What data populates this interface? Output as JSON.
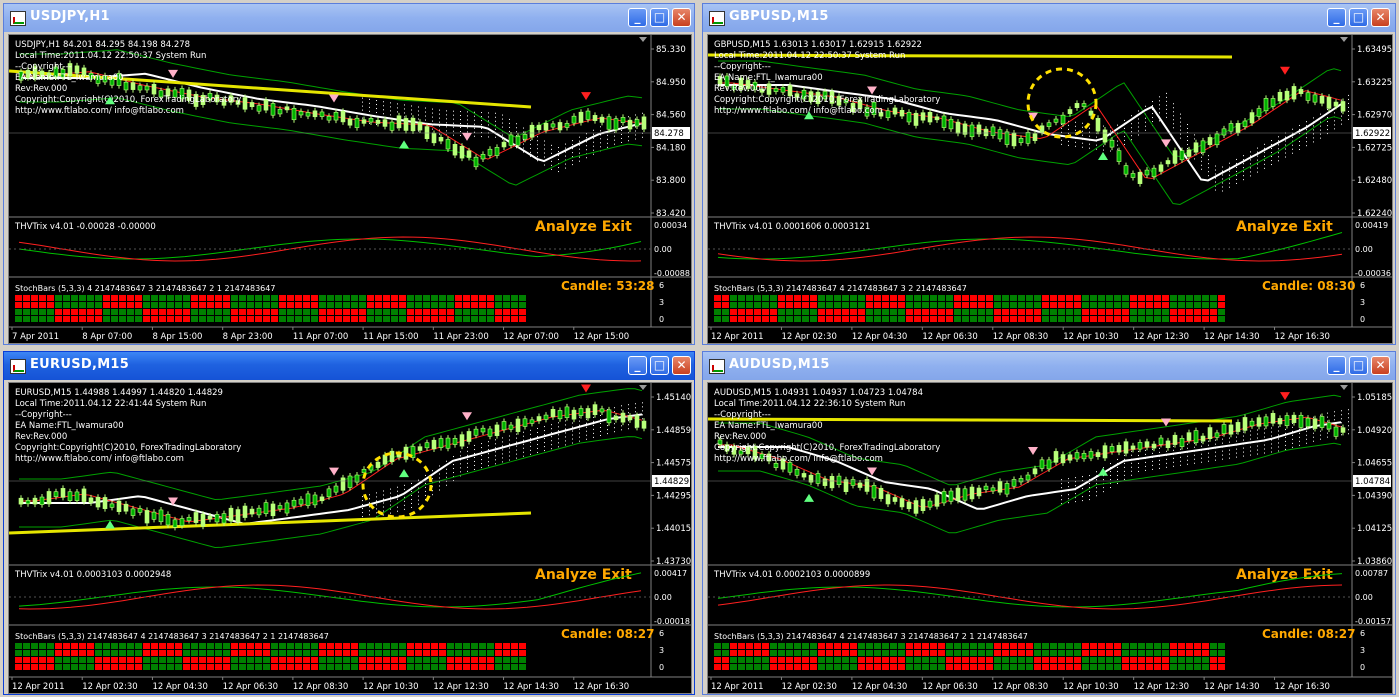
{
  "windows": [
    {
      "title": "USDJPY,H1",
      "header": [
        "USDJPY,H1  84.201 84.295 84.198 84.278",
        "Local Time:2011.04.12 22:50:37 System Run",
        "--Copyright---",
        "EA Name:FTL_Iwamura00",
        "Rev:Rev.000",
        "Copyright:Copyright(C)2010, ForexTradingLaboratory",
        "http://www.ftlabo.com/ info@ftlabo.com"
      ],
      "price_ticks": [
        "85.330",
        "84.950",
        "84.560",
        "84.180",
        "83.800",
        "83.420"
      ],
      "current_price": "84.278",
      "trix_label": "THVTrix v4.01 -0.00028 -0.00000",
      "trix_ticks": [
        "0.00034",
        "0.00",
        "-0.00088"
      ],
      "analyze": "Analyze Exit",
      "stoch_label": "StochBars (5,3,3) 4 2147483647 3 2147483647 2 1 2147483647",
      "stoch_ticks": [
        "6",
        "3",
        "0"
      ],
      "candle": "Candle:  53:28",
      "time_ticks": [
        "7 Apr 2011",
        "8 Apr 07:00",
        "8 Apr 15:00",
        "8 Apr 23:00",
        "11 Apr 07:00",
        "11 Apr 15:00",
        "11 Apr 23:00",
        "12 Apr 07:00",
        "12 Apr 15:00"
      ]
    },
    {
      "title": "GBPUSD,M15",
      "header": [
        "GBPUSD,M15  1.63013 1.63017 1.62915 1.62922",
        "Local Time:2011.04.12 22:50:37 System Run",
        "--Copyright---",
        "EA Name:FTL_Iwamura00",
        "Rev:Rev.000",
        "Copyright:Copyright(C)2010, ForexTradingLaboratory",
        "http://www.ftlabo.com/ info@ftlabo.com"
      ],
      "price_ticks": [
        "1.63495",
        "1.63225",
        "1.62970",
        "1.62725",
        "1.62480",
        "1.62240"
      ],
      "current_price": "1.62922",
      "trix_label": "THVTrix v4.01 0.0001606 0.0003121",
      "trix_ticks": [
        "0.00419",
        "0.00",
        "-0.00036"
      ],
      "analyze": "Analyze Exit",
      "stoch_label": "StochBars (5,3,3) 2147483647 4 2147483647 3 2 2147483647",
      "stoch_ticks": [
        "6",
        "3",
        "0"
      ],
      "candle": "Candle:  08:30",
      "time_ticks": [
        "12 Apr 2011",
        "12 Apr 02:30",
        "12 Apr 04:30",
        "12 Apr 06:30",
        "12 Apr 08:30",
        "12 Apr 10:30",
        "12 Apr 12:30",
        "12 Apr 14:30",
        "12 Apr 16:30"
      ]
    },
    {
      "title": "EURUSD,M15",
      "header": [
        "EURUSD,M15  1.44988 1.44997 1.44820 1.44829",
        "Local Time:2011.04.12 22:41:44 System Run",
        "--Copyright---",
        "EA Name:FTL_Iwamura00",
        "Rev:Rev.000",
        "Copyright:Copyright(C)2010, ForexTradingLaboratory",
        "http://www.ftlabo.com/ info@ftlabo.com"
      ],
      "price_ticks": [
        "1.45140",
        "1.44859",
        "1.44575",
        "1.44295",
        "1.44015",
        "1.43730"
      ],
      "current_price": "1.44829",
      "trix_label": "THVTrix v4.01 0.0003103 0.0002948",
      "trix_ticks": [
        "0.00417",
        "0.00",
        "-0.00018"
      ],
      "analyze": "Analyze Exit",
      "stoch_label": "StochBars (5,3,3) 2147483647 4 2147483647 3 2147483647 2 1 2147483647",
      "stoch_ticks": [
        "6",
        "3",
        "0"
      ],
      "candle": "Candle:  08:27",
      "time_ticks": [
        "12 Apr 2011",
        "12 Apr 02:30",
        "12 Apr 04:30",
        "12 Apr 06:30",
        "12 Apr 08:30",
        "12 Apr 10:30",
        "12 Apr 12:30",
        "12 Apr 14:30",
        "12 Apr 16:30"
      ]
    },
    {
      "title": "AUDUSD,M15",
      "header": [
        "AUDUSD,M15  1.04931 1.04937 1.04723 1.04784",
        "Local Time:2011.04.12 22:36:10 System Run",
        "--Copyright---",
        "EA Name:FTL_Iwamura00",
        "Rev:Rev.000",
        "Copyright:Copyright(C)2010, ForexTradingLaboratory",
        "http://www.ftlabo.com/ info@ftlabo.com"
      ],
      "price_ticks": [
        "1.05185",
        "1.04920",
        "1.04655",
        "1.04390",
        "1.04125",
        "1.03860"
      ],
      "current_price": "1.04784",
      "trix_label": "THVTrix v4.01 0.0002103 0.0000899",
      "trix_ticks": [
        "0.00787",
        "0.00",
        "-0.00157"
      ],
      "analyze": "Analyze Exit",
      "stoch_label": "StochBars (5,3,3) 2147483647 4 2147483647 3 2147483647 2 1 2147483647",
      "stoch_ticks": [
        "6",
        "3",
        "0"
      ],
      "candle": "Candle:  08:27",
      "time_ticks": [
        "12 Apr 2011",
        "12 Apr 02:30",
        "12 Apr 04:30",
        "12 Apr 06:30",
        "12 Apr 08:30",
        "12 Apr 10:30",
        "12 Apr 12:30",
        "12 Apr 14:30",
        "12 Apr 16:30"
      ]
    }
  ],
  "colors": {
    "analyze": "#ffa800",
    "candle": "#ffa800",
    "up_candle": "#b8ff7a",
    "down_candle": "#00b000",
    "stoch_green": "#008000",
    "stoch_red": "#ff0000"
  },
  "icons": [
    "chart-window-icon",
    "minimize-icon",
    "maximize-icon",
    "close-icon"
  ]
}
